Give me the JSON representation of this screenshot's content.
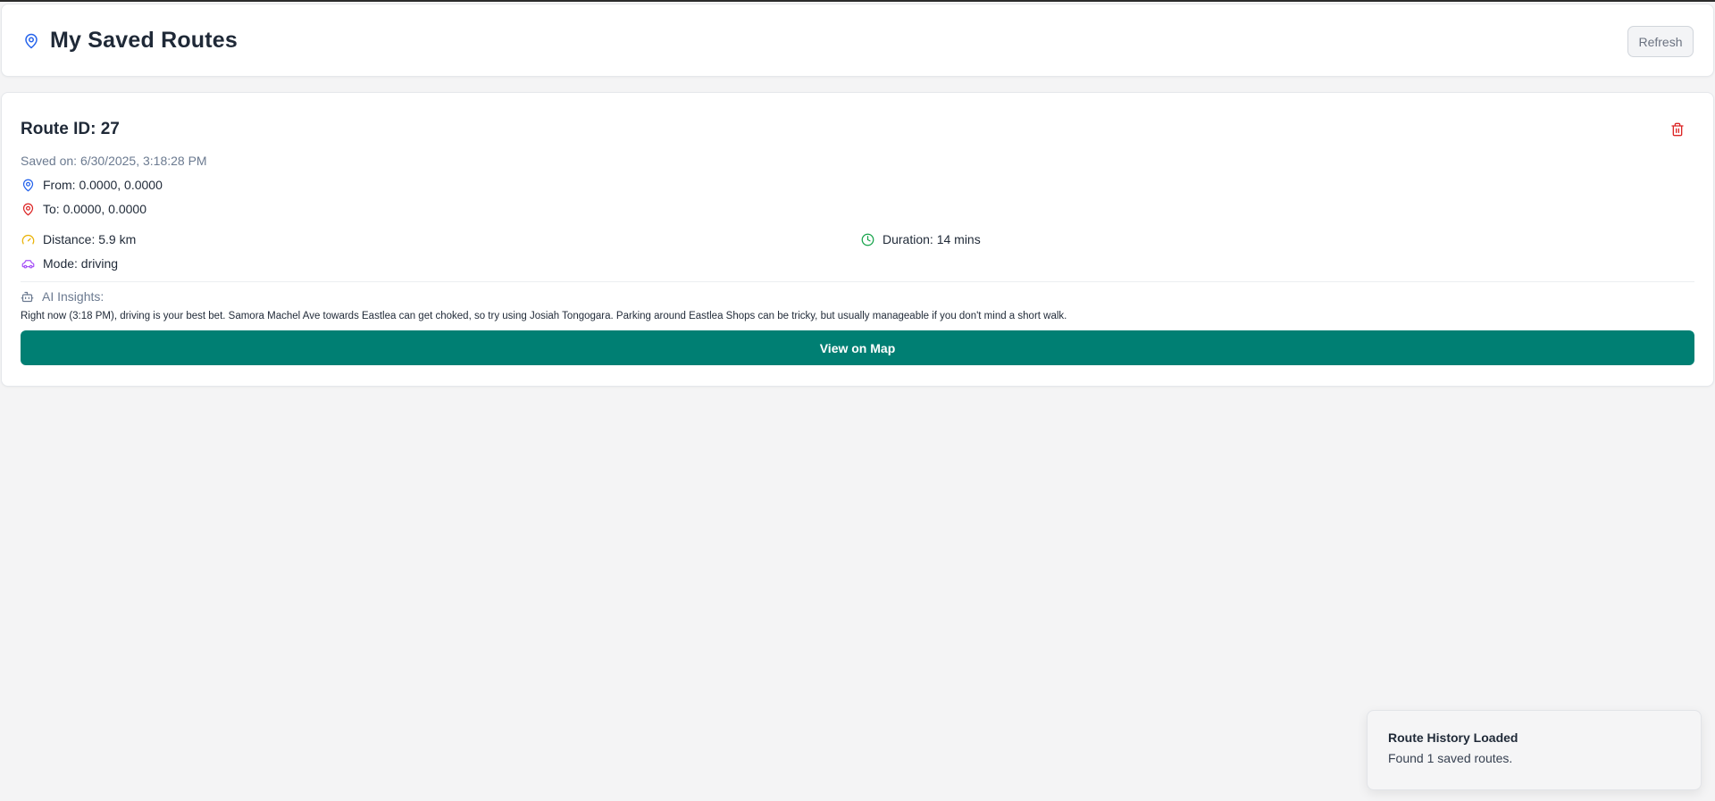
{
  "header": {
    "title": "My Saved Routes",
    "refresh_label": "Refresh"
  },
  "route": {
    "title": "Route ID: 27",
    "saved_on": "Saved on: 6/30/2025, 3:18:28 PM",
    "from": "From: 0.0000, 0.0000",
    "to": "To: 0.0000, 0.0000",
    "distance": "Distance: 5.9 km",
    "duration": "Duration: 14 mins",
    "mode": "Mode: driving",
    "ai_label": "AI Insights:",
    "ai_text": "Right now (3:18 PM), driving is your best bet. Samora Machel Ave towards Eastlea can get choked, so try using Josiah Tongogara. Parking around Eastlea Shops can be tricky, but usually manageable if you don't mind a short walk.",
    "view_map_label": "View on Map"
  },
  "toast": {
    "title": "Route History Loaded",
    "description": "Found 1 saved routes."
  },
  "icons": {
    "header": "map-pin-icon",
    "delete": "trash-icon",
    "from": "map-pin-icon",
    "to": "map-pin-icon",
    "distance": "gauge-icon",
    "duration": "clock-icon",
    "mode": "car-icon",
    "ai": "bot-icon"
  },
  "colors": {
    "accent_blue": "#2563eb",
    "danger_red": "#dc2626",
    "distance_amber": "#eab308",
    "duration_green": "#16a34a",
    "mode_purple": "#a855f7",
    "primary_teal": "#007f73"
  }
}
